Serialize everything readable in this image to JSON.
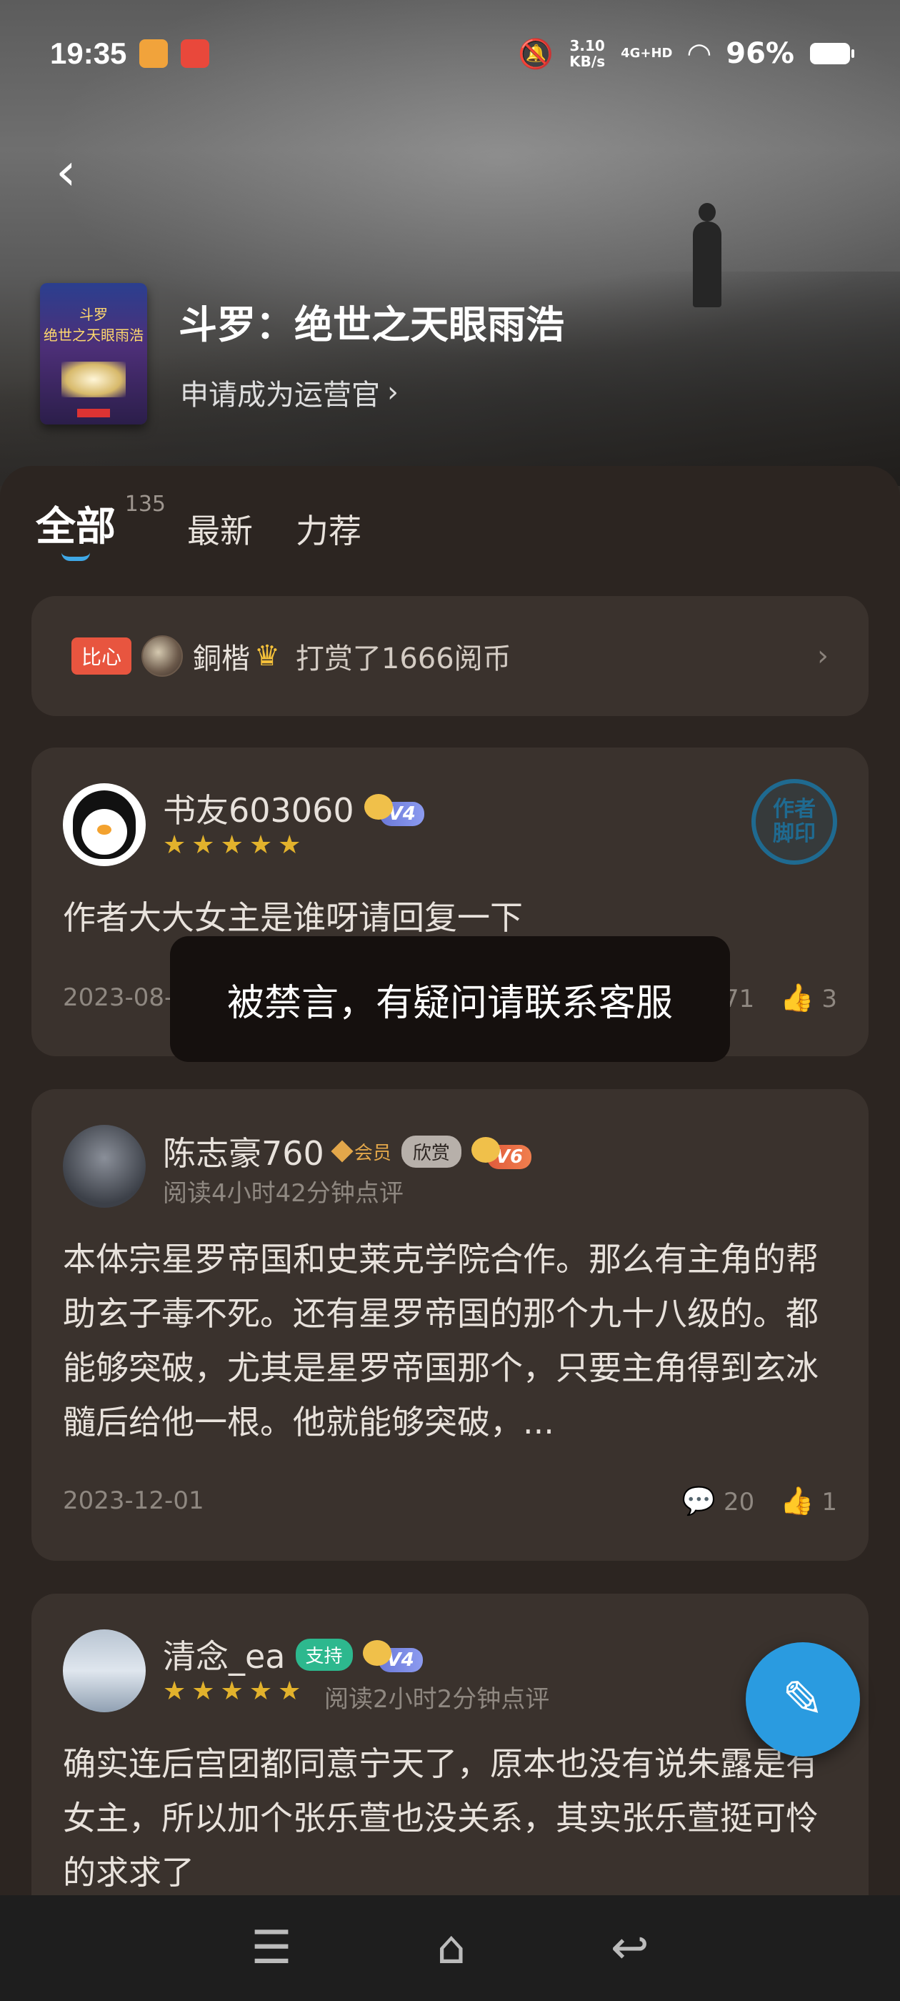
{
  "status_bar": {
    "time": "19:35",
    "speed_value": "3.10",
    "speed_unit": "KB/s",
    "network": "4G+HD",
    "battery": "96%"
  },
  "book": {
    "title": "斗罗：绝世之天眼雨浩",
    "apply_link": "申请成为运营官"
  },
  "tabs": [
    {
      "label": "全部",
      "count": "135",
      "active": true
    },
    {
      "label": "最新"
    },
    {
      "label": "力荐"
    }
  ],
  "tip_banner": {
    "badge": "比心",
    "user": "銅楷",
    "action": "打赏了1666阅币"
  },
  "comments": [
    {
      "user": "书友603060",
      "level": "V4",
      "stars": "★★★★★",
      "seal": [
        "作者",
        "脚印"
      ],
      "text": "作者大大女主是谁呀请回复一下",
      "date": "2023-08-14",
      "replies": "71",
      "likes": "3"
    },
    {
      "user": "陈志豪760",
      "vip_tag": "会员",
      "grey_tag": "欣赏",
      "level": "V6",
      "read_info": "阅读4小时42分钟点评",
      "text": "本体宗星罗帝国和史莱克学院合作。那么有主角的帮助玄子毒不死。还有星罗帝国的那个九十八级的。都能够突破，尤其是星罗帝国那个，只要主角得到玄冰髓后给他一根。他就能够突破，...",
      "date": "2023-12-01",
      "replies": "20",
      "likes": "1"
    },
    {
      "user": "清念_ea",
      "green_tag": "支持",
      "level": "V4",
      "stars": "★★★★★",
      "read_info": "阅读2小时2分钟点评",
      "text": "确实连后宫团都同意宁天了，原本也没有说朱露是有女主，所以加个张乐萱也没关系，其实张乐萱挺可怜的求求了"
    }
  ],
  "toast": "被禁言，有疑问请联系客服",
  "icons": {
    "back": "chevron-left-icon",
    "reply": "comment-bubble-icon",
    "like": "thumbs-up-icon",
    "fab": "quill-pen-icon"
  },
  "colors": {
    "accent": "#2a9be0",
    "star": "#e2b22c",
    "bixin": "#e8553f"
  }
}
